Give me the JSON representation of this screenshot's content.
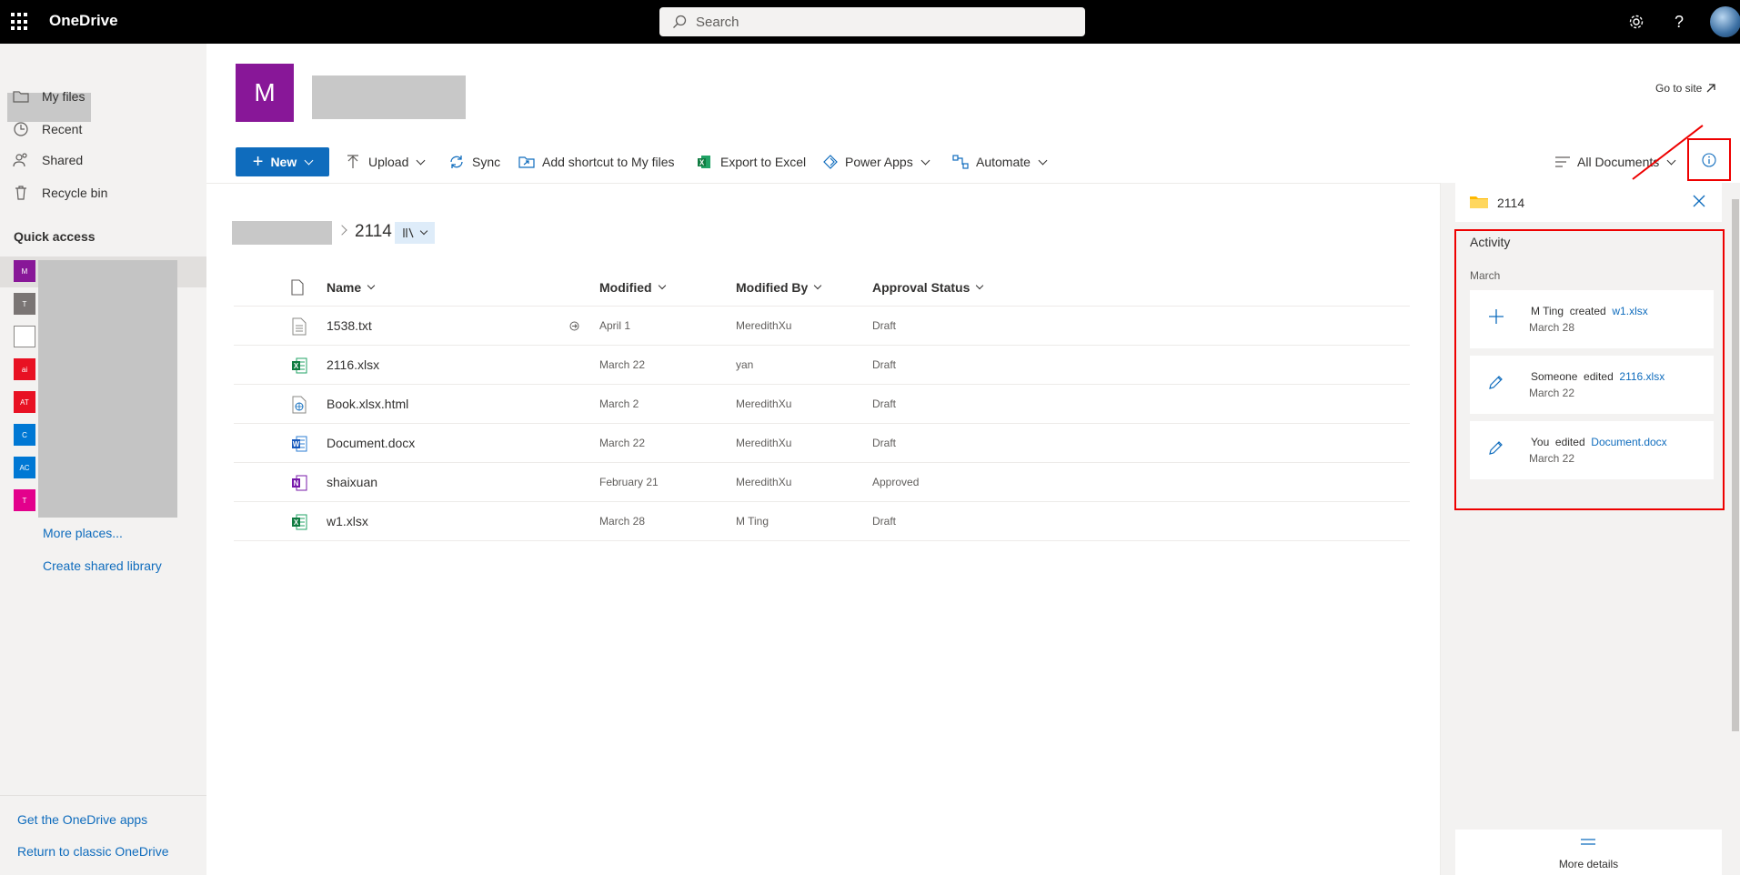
{
  "app": {
    "name": "OneDrive"
  },
  "search": {
    "placeholder": "Search"
  },
  "sidebar": {
    "nav": [
      {
        "label": "My files"
      },
      {
        "label": "Recent"
      },
      {
        "label": "Shared"
      },
      {
        "label": "Recycle bin"
      }
    ],
    "quick_access_title": "Quick access",
    "quick_access_tiles": [
      {
        "text": "M",
        "color": "#881798"
      },
      {
        "text": "T",
        "color": "#7a7574"
      },
      {
        "text": "",
        "color": "#ffffff"
      },
      {
        "text": "ai",
        "color": "#e81123"
      },
      {
        "text": "AT",
        "color": "#e81123"
      },
      {
        "text": "C",
        "color": "#0078d4"
      },
      {
        "text": "AC",
        "color": "#0078d4"
      },
      {
        "text": "T",
        "color": "#e3008c"
      }
    ],
    "more_places": "More places...",
    "create_library": "Create shared library",
    "get_apps": "Get the OneDrive apps",
    "return_classic": "Return to classic OneDrive"
  },
  "site": {
    "logo_letter": "M",
    "go_to_site": "Go to site"
  },
  "command_bar": {
    "new": "New",
    "upload": "Upload",
    "sync": "Sync",
    "add_shortcut": "Add shortcut to My files",
    "export": "Export to Excel",
    "power_apps": "Power Apps",
    "automate": "Automate",
    "view": "All Documents"
  },
  "breadcrumb": {
    "current": "2114"
  },
  "table": {
    "headers": {
      "name": "Name",
      "modified": "Modified",
      "modified_by": "Modified By",
      "approval": "Approval Status"
    },
    "rows": [
      {
        "name": "1538.txt",
        "type": "txt",
        "modified": "April 1",
        "modified_by": "MeredithXu",
        "approval": "Draft"
      },
      {
        "name": "2116.xlsx",
        "type": "xlsx",
        "modified": "March 22",
        "modified_by": "yan",
        "approval": "Draft"
      },
      {
        "name": "Book.xlsx.html",
        "type": "html",
        "modified": "March 2",
        "modified_by": "MeredithXu",
        "approval": "Draft"
      },
      {
        "name": "Document.docx",
        "type": "docx",
        "modified": "March 22",
        "modified_by": "MeredithXu",
        "approval": "Draft"
      },
      {
        "name": "shaixuan",
        "type": "onenote",
        "modified": "February 21",
        "modified_by": "MeredithXu",
        "approval": "Approved"
      },
      {
        "name": "w1.xlsx",
        "type": "xlsx",
        "modified": "March 28",
        "modified_by": "M Ting",
        "approval": "Draft"
      }
    ]
  },
  "details": {
    "title": "2114",
    "activity_title": "Activity",
    "month": "March",
    "activities": [
      {
        "actor": "M Ting",
        "action": "created",
        "file": "w1.xlsx",
        "date": "March 28",
        "icon": "plus-icon"
      },
      {
        "actor": "Someone",
        "action": "edited",
        "file": "2116.xlsx",
        "date": "March 22",
        "icon": "pencil-icon"
      },
      {
        "actor": "You",
        "action": "edited",
        "file": "Document.docx",
        "date": "March 22",
        "icon": "pencil-icon"
      }
    ],
    "more_details": "More details"
  },
  "colors": {
    "accent": "#0f6cbd",
    "highlight": "#e00000",
    "site_logo": "#881798"
  }
}
